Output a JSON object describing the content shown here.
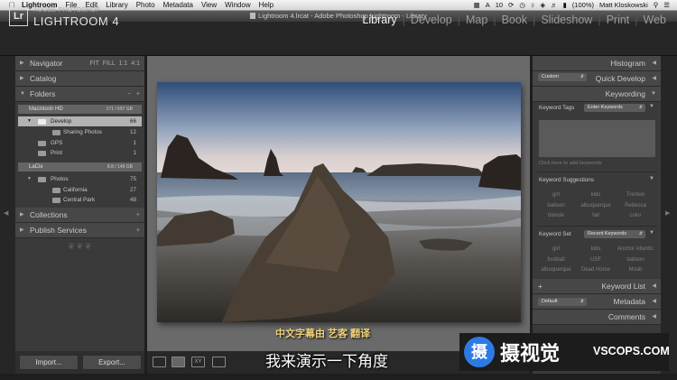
{
  "menubar": {
    "app": "Lightroom",
    "items": [
      "File",
      "Edit",
      "Library",
      "Photo",
      "Metadata",
      "View",
      "Window",
      "Help"
    ],
    "status_badge": "10",
    "battery": "(100%)",
    "user": "Matt Kloskowski"
  },
  "window": {
    "title": "Lightroom 4.lrcat - Adobe Photoshop Lightroom - Library"
  },
  "brand": {
    "logo": "Lr",
    "line1": "ADOBE PHOTOSHOP",
    "line2": "LIGHTROOM 4"
  },
  "modules": [
    "Library",
    "Develop",
    "Map",
    "Book",
    "Slideshow",
    "Print",
    "Web"
  ],
  "left_panel": {
    "navigator": {
      "label": "Navigator",
      "zoom_options": [
        "FIT",
        "FILL",
        "1:1",
        "4:1"
      ]
    },
    "catalog": {
      "label": "Catalog"
    },
    "folders": {
      "label": "Folders",
      "volumes": [
        {
          "name": "Macintosh HD",
          "usage": "171 / 697 GB",
          "folders": [
            {
              "name": "Develop",
              "count": "66"
            },
            {
              "name": "Sharing Photos",
              "count": "12"
            },
            {
              "name": "GPS",
              "count": "1"
            },
            {
              "name": "Print",
              "count": "1"
            }
          ]
        },
        {
          "name": "LaCie",
          "usage": "8.8 / 149 GB",
          "folders": [
            {
              "name": "Photos",
              "count": "75"
            },
            {
              "name": "California",
              "count": "27"
            },
            {
              "name": "Central Park",
              "count": "48"
            }
          ]
        }
      ]
    },
    "collections": {
      "label": "Collections"
    },
    "publish": {
      "label": "Publish Services"
    },
    "import_label": "Import...",
    "export_label": "Export..."
  },
  "right_panel": {
    "histogram": "Histogram",
    "quick_develop": {
      "preset": "Custom",
      "label": "Quick Develop"
    },
    "keywording": {
      "label": "Keywording",
      "tags_label": "Keyword Tags",
      "tags_mode": "Enter Keywords",
      "hint": "Click here to add keywords",
      "suggestions_label": "Keyword Suggestions",
      "suggestions": [
        "girl",
        "kids",
        "Trenton",
        "balloon",
        "albuquerque",
        "Rebecca",
        "blonde",
        "fall",
        "color"
      ],
      "set_label": "Keyword Set",
      "set_value": "Recent Keywords",
      "set_items": [
        "girl",
        "kids",
        "Anchor Atlantic",
        "football",
        "USF",
        "balloon",
        "albuquerque",
        "Dead Horse",
        "Moab"
      ]
    },
    "keyword_list": "Keyword List",
    "metadata": {
      "preset": "Default",
      "label": "Metadata"
    },
    "comments": "Comments"
  },
  "subtitles": {
    "credit": "中文字幕由 艺客 翻译",
    "line": "我来演示一下角度"
  },
  "watermark": {
    "name": "摄视觉",
    "url": "VSCOPS.COM",
    "mark": "摄"
  }
}
